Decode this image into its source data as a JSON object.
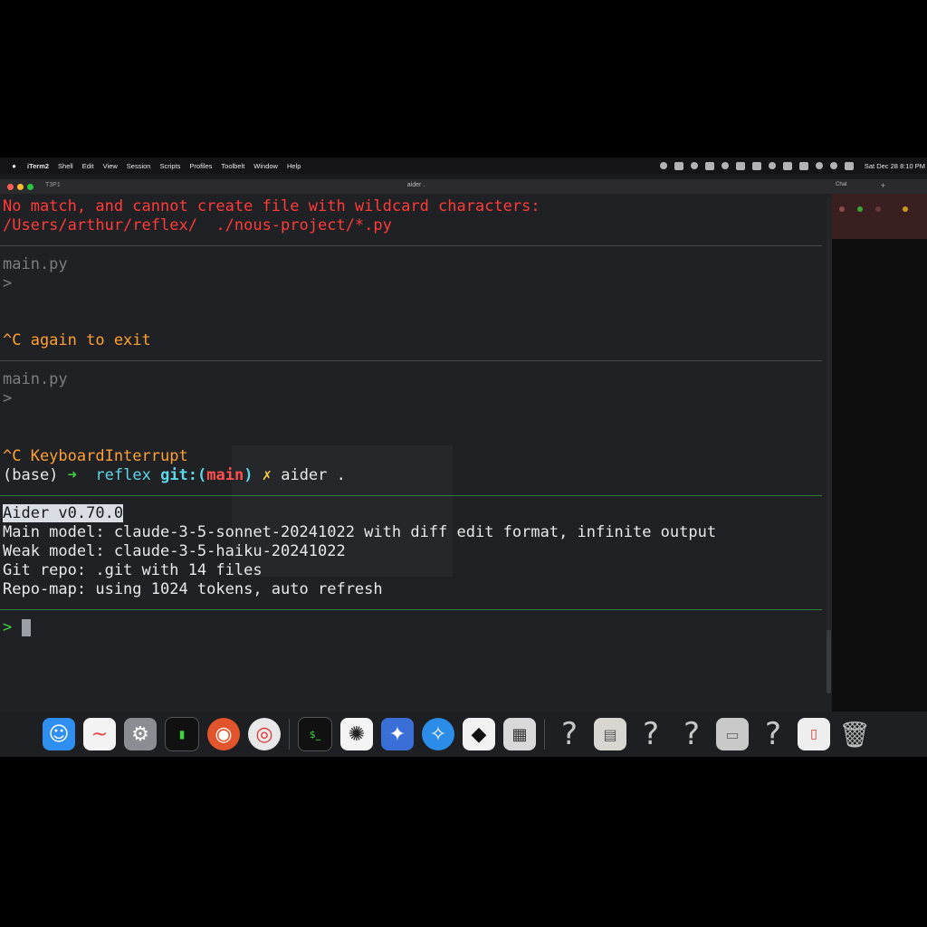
{
  "menubar": {
    "app": "iTerm2",
    "items": [
      "Shell",
      "Edit",
      "View",
      "Session",
      "Scripts",
      "Profiles",
      "Toolbelt",
      "Window",
      "Help"
    ],
    "clock": "Sat Dec 28  8:10 PM"
  },
  "terminal": {
    "tab_label": "T3P1",
    "window_title": "aider .",
    "lines": {
      "err1": "No match, and cannot create file with wildcard characters:",
      "err2": "/Users/arthur/reflex/  ./nous-project/*.py",
      "file1": "main.py",
      "prompt1": ">",
      "interrupt1": "^C again to exit",
      "file2": "main.py",
      "prompt2": ">",
      "interrupt2": "^C KeyboardInterrupt",
      "shell_env": "(base)",
      "shell_arrow": "➜",
      "shell_dir": "reflex",
      "shell_git": "git:(",
      "shell_branch": "main",
      "shell_git_close": ")",
      "shell_x": "✗",
      "shell_cmd": "aider .",
      "version": "Aider v0.70.0",
      "main_model": "Main model: claude-3-5-sonnet-20241022 with diff edit format, infinite output",
      "weak_model": "Weak model: claude-3-5-haiku-20241022",
      "git_repo": "Git repo: .git with 14 files",
      "repo_map": "Repo-map: using 1024 tokens, auto refresh",
      "input_prompt": ">"
    }
  },
  "side_window": {
    "tab_label": "Chat",
    "plus": "+"
  },
  "dock": {
    "icons": [
      "finder-icon",
      "freeform-icon",
      "system-settings-icon",
      "activity-monitor-icon",
      "firefox-icon",
      "chrome-icon",
      "terminal-icon",
      "chatgpt-icon",
      "xcode-icon",
      "safari-icon",
      "cursor-icon",
      "calculator-icon",
      "unknown-app-icon",
      "preview-icon",
      "unknown-app-icon",
      "unknown-app-icon",
      "document-icon",
      "unknown-app-icon",
      "pdf-icon",
      "trash-icon"
    ]
  },
  "colors": {
    "error": "#ff3b3b",
    "interrupt": "#ffa033",
    "prompt_green": "#3ed43e",
    "git_cyan": "#5fd7e8"
  }
}
